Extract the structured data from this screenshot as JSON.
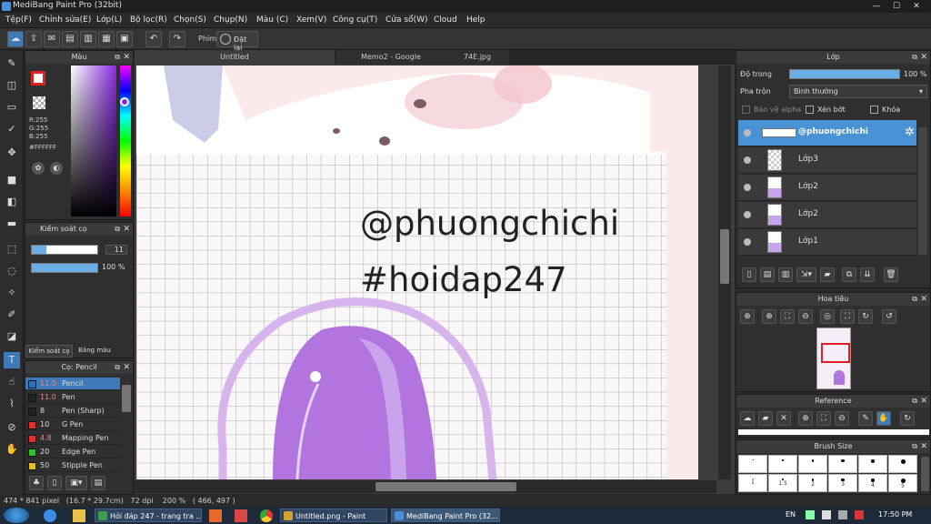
{
  "window": {
    "title": "MediBang Paint Pro (32bit)"
  },
  "menu": [
    "Tệp(F)",
    "Chỉnh sửa(E)",
    "Lớp(L)",
    "Bộ lọc(R)",
    "Chọn(S)",
    "Chụp(N)",
    "Màu (C)",
    "Xem(V)",
    "Công cụ(T)",
    "Cửa sổ(W)",
    "Cloud",
    "Help"
  ],
  "toolbar": {
    "brush_label": "Phím",
    "reset_label": "Đặt lại"
  },
  "color_panel": {
    "title": "Màu",
    "r": "R:255",
    "g": "G:255",
    "b": "B:255",
    "hex": "#FFFFFF"
  },
  "brush_control": {
    "title": "Kiểm soát cọ",
    "size": "11",
    "opacity": "100 %",
    "tab1": "Kiểm soát cọ",
    "tab2": "Bảng màu"
  },
  "brush_panel": {
    "title": "Cọ: Pencil",
    "items": [
      {
        "size": "11.0",
        "name": "Pencil",
        "color": "#2f6fb3"
      },
      {
        "size": "11.0",
        "name": "Pen",
        "color": "#222222"
      },
      {
        "size": "8",
        "name": "Pen (Sharp)",
        "color": "#222222"
      },
      {
        "size": "10",
        "name": "G Pen",
        "color": "#e03030"
      },
      {
        "size": "4.8",
        "name": "Mapping Pen",
        "color": "#e03030"
      },
      {
        "size": "20",
        "name": "Edge Pen",
        "color": "#30c030"
      },
      {
        "size": "50",
        "name": "Stipple Pen",
        "color": "#e0c020"
      }
    ]
  },
  "tabs": [
    "Untitled",
    "Memo2 - Google",
    "74E.jpg"
  ],
  "canvas_text": {
    "line1": "@phuongchichi",
    "line2": "#hoidap247"
  },
  "layer_panel": {
    "title": "Lớp",
    "opacity_label": "Độ trong",
    "opacity_value": "100 %",
    "opacity_fraction": 1.0,
    "blend_label": "Pha trộn",
    "blend_value": "Bình thường",
    "protect_alpha": "Bảo vệ alpha",
    "clipping": "Xén bớt",
    "lock": "Khóa",
    "layers": [
      "@phuongchichi",
      "Lớp3",
      "Lớp2",
      "Lớp2",
      "Lớp1"
    ]
  },
  "navigator": {
    "title": "Hoa tiêu"
  },
  "reference": {
    "title": "Reference"
  },
  "brush_size": {
    "title": "Brush Size",
    "sizes": [
      "1",
      "1.5",
      "2",
      "3",
      "4",
      "5"
    ]
  },
  "status": {
    "text": "474 * 841 pixel   (16.7 * 29.7cm)   72 dpi    200 %   ( 466, 497 )"
  },
  "taskbar": {
    "items": [
      "Hỏi đáp 247 - trang tra ...",
      "Untitled.png - Paint",
      "MediBang Paint Pro (32..."
    ],
    "lang": "EN",
    "clock": "17:50 PM"
  }
}
